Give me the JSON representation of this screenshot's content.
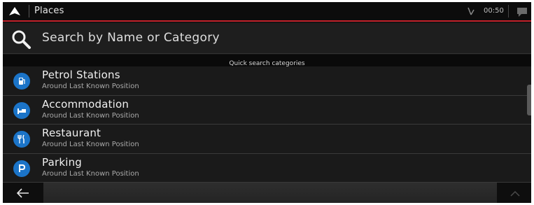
{
  "header": {
    "title": "Places",
    "clock": "00:50",
    "icons": [
      "navigation-arrow-icon",
      "gps-status-icon",
      "message-icon"
    ]
  },
  "search": {
    "placeholder": "Search by Name or Category",
    "icon": "search-icon"
  },
  "section": {
    "label": "Quick search categories"
  },
  "categories": [
    {
      "label": "Petrol Stations",
      "sub": "Around Last Known Position",
      "icon": "fuel-pump-icon"
    },
    {
      "label": "Accommodation",
      "sub": "Around Last Known Position",
      "icon": "bed-icon"
    },
    {
      "label": "Restaurant",
      "sub": "Around Last Known Position",
      "icon": "fork-knife-icon"
    },
    {
      "label": "Parking",
      "sub": "Around Last Known Position",
      "icon": "parking-icon"
    }
  ],
  "footer": {
    "icons": [
      "back-arrow-icon",
      "scroll-up-icon"
    ]
  },
  "colors": {
    "accent": "#c0202a",
    "icon_blue": "#1b74c8",
    "background": "#141414"
  }
}
